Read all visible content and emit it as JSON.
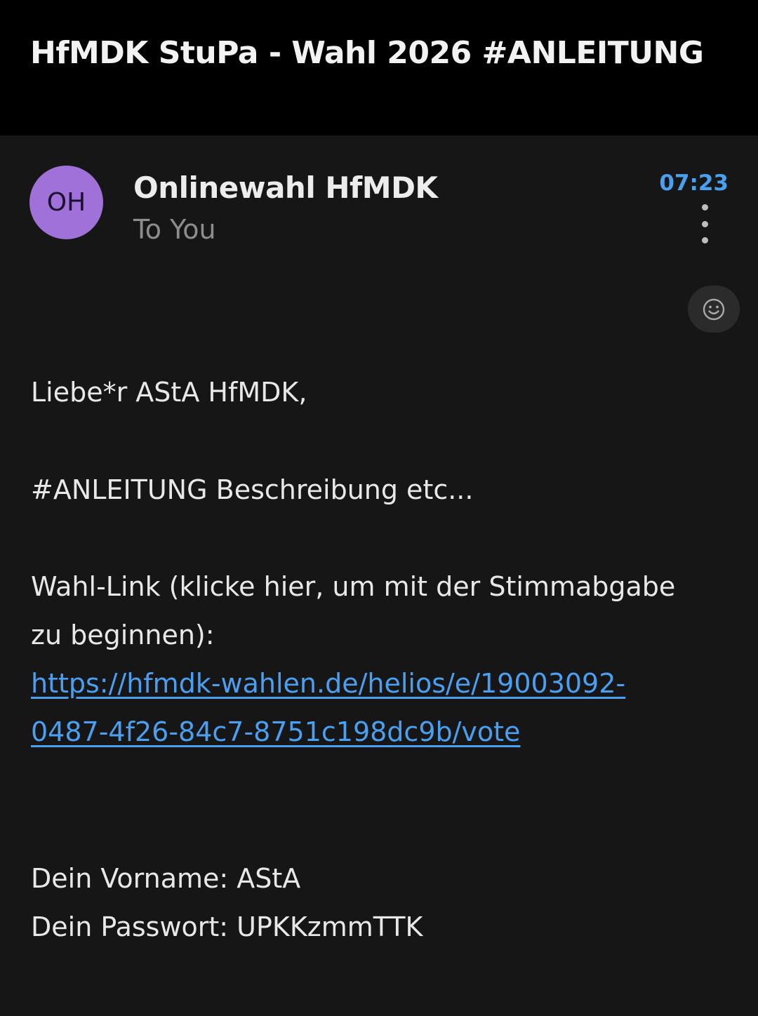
{
  "header": {
    "subject": "HfMDK StuPa - Wahl 2026 #ANLEITUNG"
  },
  "message": {
    "avatar_initials": "OH",
    "sender": "Onlinewahl HfMDK",
    "recipient": "To You",
    "time": "07:23",
    "colors": {
      "avatar": "#a072d9",
      "time": "#4aa0f0",
      "link": "#4a9ff0"
    },
    "body": {
      "greeting": "Liebe*r AStA HfMDK,",
      "description": "#ANLEITUNG Beschreibung etc...",
      "link_intro": "Wahl-Link (klicke hier, um mit der Stimmabgabe zu beginnen):",
      "link_line1": "https://hfmdk-wahlen.de/helios/e/19003092-",
      "link_line2": "0487-4f26-84c7-8751c198dc9b/vote",
      "firstname_line": "Dein Vorname: AStA",
      "password_line": "Dein Passwort: UPKKzmmTTK"
    }
  },
  "icons": {
    "more": "more-vertical-icon",
    "reaction": "smiley-icon"
  }
}
